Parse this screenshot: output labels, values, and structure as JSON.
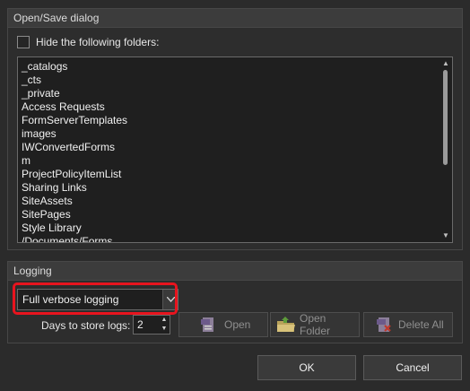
{
  "open_save": {
    "title": "Open/Save dialog",
    "hide_checkbox_label": "Hide the following folders:",
    "folders": [
      "_catalogs",
      "_cts",
      "_private",
      "Access Requests",
      "FormServerTemplates",
      "images",
      "IWConvertedForms",
      "m",
      "ProjectPolicyItemList",
      "Sharing Links",
      "SiteAssets",
      "SitePages",
      "Style Library",
      "/Documents/Forms"
    ]
  },
  "logging": {
    "title": "Logging",
    "level_selected": "Full verbose logging",
    "days_label": "Days to store logs:",
    "days_value": "2",
    "open_label": "Open",
    "open_folder_label": "Open Folder",
    "delete_all_label": "Delete All"
  },
  "dialog": {
    "ok_label": "OK",
    "cancel_label": "Cancel"
  },
  "colors": {
    "highlight": "#e8141e",
    "background": "#2b2b2b"
  }
}
